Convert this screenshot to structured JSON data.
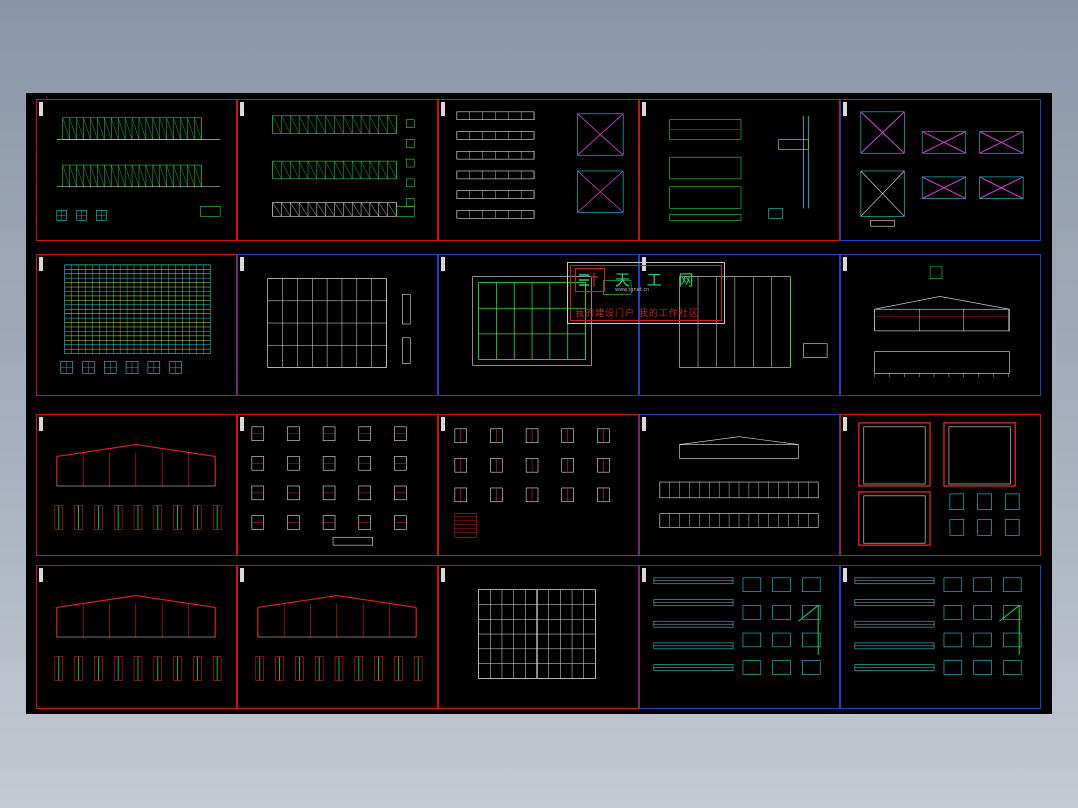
{
  "viewer": {
    "background_top": "#8a96a8",
    "background_bottom": "#c4cad3",
    "canvas_color": "#000000"
  },
  "sheets": [
    {
      "kind": "elevation",
      "frame": "red"
    },
    {
      "kind": "elevation3",
      "frame": "red"
    },
    {
      "kind": "bracing",
      "frame": "red"
    },
    {
      "kind": "beams",
      "frame": "red"
    },
    {
      "kind": "xbrace",
      "frame": "blue"
    },
    {
      "kind": "dense",
      "frame": "red"
    },
    {
      "kind": "plan_white",
      "frame": "blue"
    },
    {
      "kind": "plan_green",
      "frame": "blue"
    },
    {
      "kind": "plan_simple",
      "frame": "blue"
    },
    {
      "kind": "section_small",
      "frame": "blue"
    },
    {
      "kind": "frame_red",
      "frame": "red"
    },
    {
      "kind": "details",
      "frame": "red"
    },
    {
      "kind": "details2",
      "frame": "red"
    },
    {
      "kind": "elev_white",
      "frame": "blue"
    },
    {
      "kind": "portal",
      "frame": "red"
    },
    {
      "kind": "frame_red",
      "frame": "red"
    },
    {
      "kind": "frame_red",
      "frame": "red"
    },
    {
      "kind": "plan_grid",
      "frame": "red"
    },
    {
      "kind": "cyan_details",
      "frame": "blue"
    },
    {
      "kind": "cyan_details",
      "frame": "blue"
    }
  ],
  "colors": {
    "red": "#e02020",
    "green": "#22e040",
    "cyan": "#20d8e0",
    "yellow": "#e8e020",
    "white": "#e8e8e8",
    "magenta": "#e040e0",
    "blue_frame": "#2040c8"
  },
  "watermark": {
    "title": "天 工 网",
    "url": "www.tgnet.cn",
    "slogan": "我的建设门户 我的工作社区"
  }
}
